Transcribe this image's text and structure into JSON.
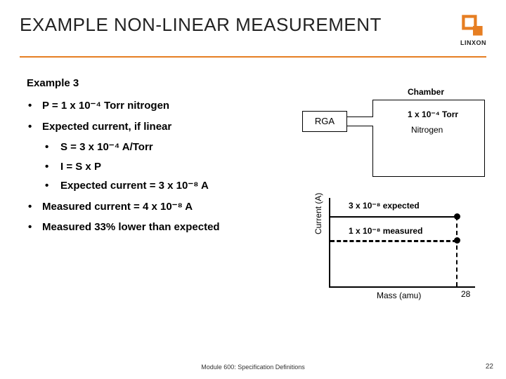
{
  "header": {
    "title": "EXAMPLE NON-LINEAR MEASUREMENT",
    "brand": "LINXON"
  },
  "subhead": "Example 3",
  "bullets": {
    "b1": "P = 1 x 10⁻⁴ Torr nitrogen",
    "b2": "Expected current, if linear",
    "b2a": "S = 3 x 10⁻⁴ A/Torr",
    "b2b": "I = S x P",
    "b2c": "Expected current  = 3 x 10⁻⁸ A",
    "b3": "Measured current = 4 x 10⁻⁸ A",
    "b4": "Measured 33% lower than expected"
  },
  "diagram": {
    "rga": "RGA",
    "chamber": "Chamber",
    "pressure": "1 x 10⁻⁴ Torr",
    "gas": "Nitrogen"
  },
  "plot": {
    "ylabel": "Current (A)",
    "xlabel": "Mass (amu)",
    "xtick": "28",
    "expected_label": "3 x 10⁻⁸ expected",
    "measured_label": "1 x 10⁻⁸ measured"
  },
  "footer": {
    "module": "Module 600: Specification Definitions",
    "page": "22"
  },
  "chart_data": {
    "type": "line",
    "title": "",
    "xlabel": "Mass (amu)",
    "ylabel": "Current (A)",
    "series": [
      {
        "name": "expected",
        "style": "solid",
        "peak_mass": 28,
        "peak_current_A": 3e-08
      },
      {
        "name": "measured",
        "style": "dashed",
        "peak_mass": 28,
        "peak_current_A": 1e-08
      }
    ],
    "xticks": [
      28
    ]
  }
}
